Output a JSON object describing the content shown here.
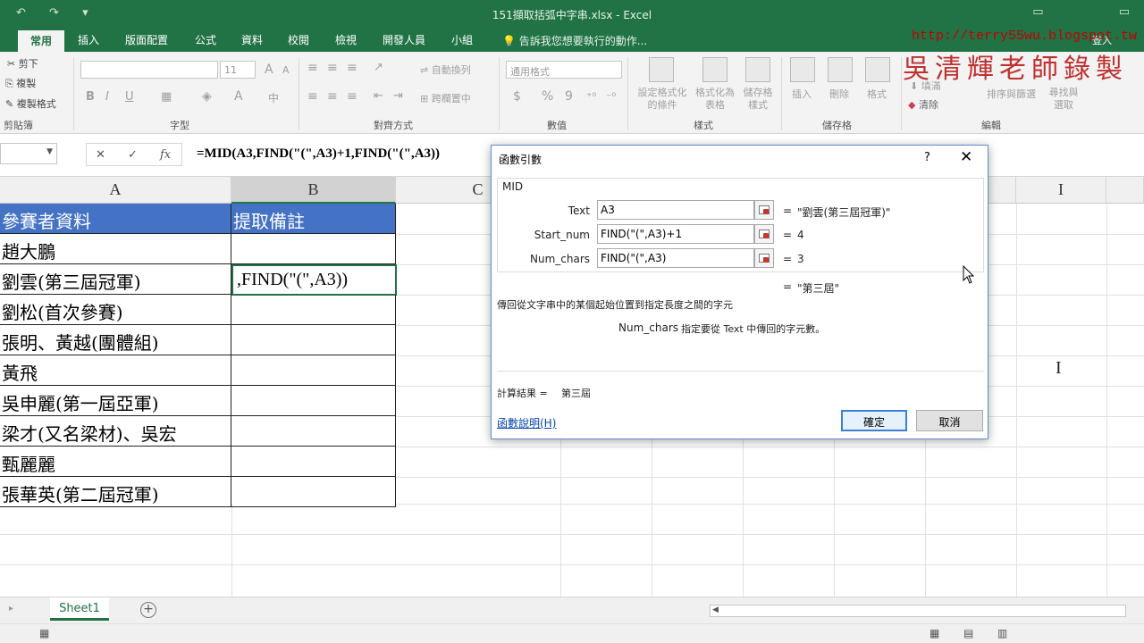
{
  "app": {
    "doc_title": "151擷取括弧中字串.xlsx - Excel",
    "qat_undo": "↶",
    "qat_redo": "↷",
    "qat_more": "▾",
    "minimize_icon": "▭",
    "restore_icon": "▭"
  },
  "tabs": {
    "items": [
      "常用",
      "插入",
      "版面配置",
      "公式",
      "資料",
      "校閱",
      "檢視",
      "開發人員",
      "小組"
    ],
    "active": "常用",
    "tell_me": "告訴我您想要執行的動作...",
    "login": "登入"
  },
  "watermark": {
    "url": "http://terry55wu.blogspot.tw",
    "name": "吳清輝老師錄製"
  },
  "ribbon": {
    "clipboard": {
      "cut": "剪下",
      "copy": "複製",
      "format_painter": "複製格式",
      "label": "剪貼簿"
    },
    "font": {
      "size": "11",
      "bold": "B",
      "italic": "I",
      "underline": "U",
      "label": "字型",
      "grow": "A",
      "shrink": "A"
    },
    "alignment": {
      "wrap": "自動換列",
      "merge": "跨欄置中",
      "label": "對齊方式"
    },
    "number": {
      "format": "通用格式",
      "currency": "$",
      "percent": "%",
      "comma": "9",
      "label": "數值"
    },
    "styles": {
      "conditional": "設定格式化的條件",
      "table": "格式化為表格",
      "cell_styles": "儲存格樣式",
      "label": "樣式",
      "cond_line1": "設定格式化",
      "cond_line2": "的條件",
      "table_line1": "格式化為",
      "table_line2": "表格",
      "cell_line1": "儲存格",
      "cell_line2": "樣式"
    },
    "cells": {
      "insert": "插入",
      "delete": "刪除",
      "format": "格式",
      "label": "儲存格"
    },
    "editing": {
      "fill": "填滿",
      "clear": "清除",
      "sort": "排序與篩選",
      "find_line1": "尋找與",
      "find_line2": "選取",
      "label": "編輯"
    }
  },
  "formula_bar": {
    "cancel": "✕",
    "enter": "✓",
    "fx": "fx",
    "formula": "=MID(A3,FIND(\"(\",A3)+1,FIND(\"(\",A3))"
  },
  "sheet": {
    "col_headers": [
      "A",
      "B",
      "C",
      "I"
    ],
    "a1": "參賽者資料",
    "b1": "提取備註",
    "rows": [
      "趙大鵬",
      "劉雲(第三屆冠軍)",
      "劉松(首次參賽)",
      "張明、黃越(團體組)",
      "黃飛",
      "吳申麗(第一屆亞軍)",
      "梁才(又名梁材)、吳宏",
      "甄麗麗",
      "張華英(第二屆冠軍)"
    ],
    "b3_editing": ",FIND(\"(\",A3))",
    "sheet_tab": "Sheet1",
    "add_sheet": "+"
  },
  "dialog": {
    "title": "函數引數",
    "help": "?",
    "close": "✕",
    "function": "MID",
    "args": [
      {
        "label": "Text",
        "input": "A3",
        "value": "\"劉雲(第三屆冠軍)\""
      },
      {
        "label": "Start_num",
        "input": "FIND(\"(\",A3)+1",
        "value": "4"
      },
      {
        "label": "Num_chars",
        "input": "FIND(\"(\",A3)",
        "value": "3"
      }
    ],
    "eq": "=",
    "overall_value": "\"第三屆\"",
    "description": "傳回從文字串中的某個起始位置到指定長度之間的字元",
    "arg_desc_name": "Num_chars",
    "arg_desc_text": "指定要從 Text 中傳回的字元數。",
    "result_label": "計算結果 =",
    "result_value": "第三屆",
    "help_link": "函數說明(H)",
    "ok": "確定",
    "cancel": "取消"
  }
}
